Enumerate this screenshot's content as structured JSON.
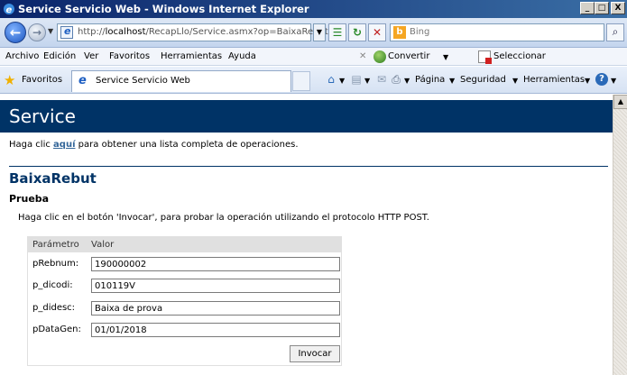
{
  "window": {
    "title": "Service Servicio Web - Windows Internet Explorer",
    "min_glyph": "_",
    "max_glyph": "□",
    "close_glyph": "X"
  },
  "address": {
    "url_prefix": "http://",
    "url_host": "localhost",
    "url_path": "/RecapLlo/Service.asmx?op=BaixaRebut",
    "search_placeholder": "Bing"
  },
  "menu": {
    "items": [
      "Archivo",
      "Edición",
      "Ver",
      "Favoritos",
      "Herramientas",
      "Ayuda"
    ],
    "convertir": "Convertir",
    "seleccionar": "Seleccionar"
  },
  "favbar": {
    "favorites_label": "Favoritos",
    "tab_label": "Service Servicio Web",
    "cmd_pagina": "Página",
    "cmd_seguridad": "Seguridad",
    "cmd_herramientas": "Herramientas"
  },
  "page": {
    "banner_title": "Service",
    "intro_before": "Haga clic ",
    "intro_link": "aquí",
    "intro_after": " para obtener una lista completa de operaciones.",
    "operation_title": "BaixaRebut",
    "section_title": "Prueba",
    "test_description": "Haga clic en el botón 'Invocar', para probar la operación utilizando el protocolo HTTP POST.",
    "table": {
      "header_param": "Parámetro",
      "header_value": "Valor",
      "rows": [
        {
          "label": "pRebnum:",
          "value": "190000002"
        },
        {
          "label": "p_dicodi:",
          "value": "010119V"
        },
        {
          "label": "p_didesc:",
          "value": "Baixa de prova"
        },
        {
          "label": "pDataGen:",
          "value": "01/01/2018"
        }
      ]
    },
    "invoke_label": "Invocar"
  }
}
